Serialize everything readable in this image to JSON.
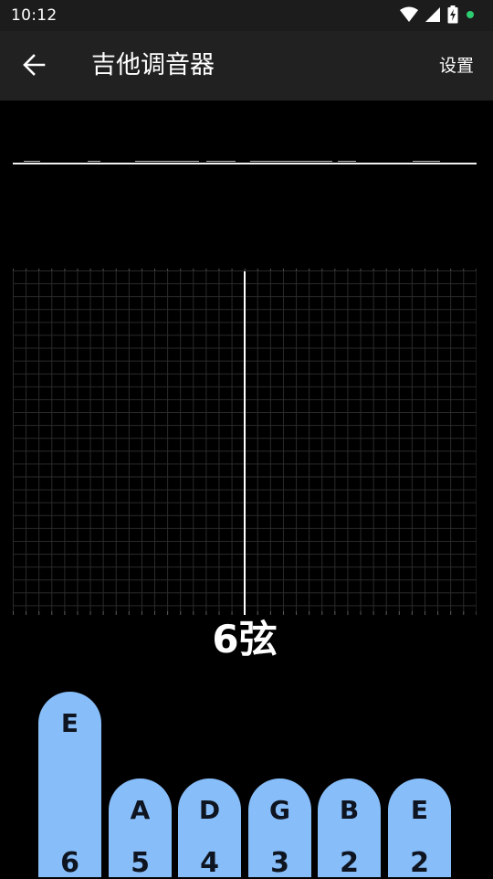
{
  "status_bar": {
    "time": "10:12",
    "icons": [
      "wifi-icon",
      "cell-signal-icon",
      "battery-charging-icon",
      "notification-dot-icon"
    ],
    "dot_color": "#2ecc71"
  },
  "app_bar": {
    "back_icon": "arrow-left-icon",
    "title": "吉他调音器",
    "settings_label": "设置"
  },
  "tuner": {
    "current_string": "6弦",
    "needle_position": 0.5
  },
  "strings": [
    {
      "note": "E",
      "number": "6",
      "selected": true
    },
    {
      "note": "A",
      "number": "5",
      "selected": false
    },
    {
      "note": "D",
      "number": "4",
      "selected": false
    },
    {
      "note": "G",
      "number": "3",
      "selected": false
    },
    {
      "note": "B",
      "number": "2",
      "selected": false
    },
    {
      "note": "E",
      "number": "2",
      "selected": false
    }
  ],
  "colors": {
    "background": "#000000",
    "app_bar": "#212121",
    "peg": "#87bdf9",
    "grid_line": "#2b2b2b"
  }
}
